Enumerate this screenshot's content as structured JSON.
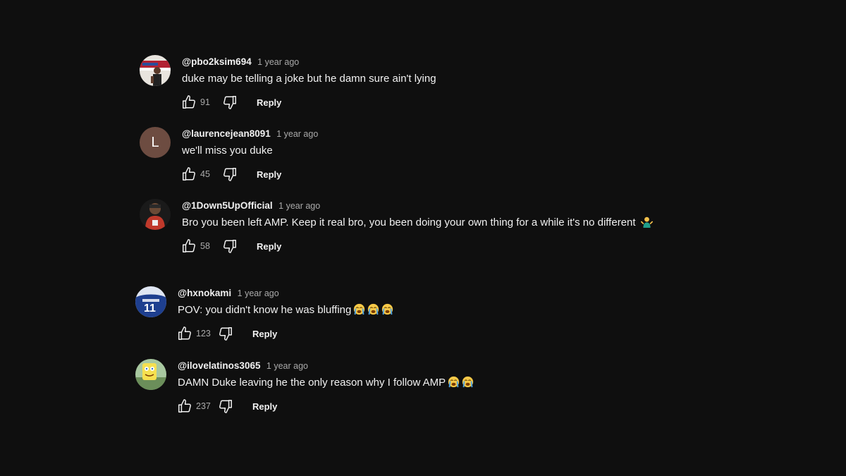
{
  "comments": [
    {
      "handle": "@pbo2ksim694",
      "time": "1 year ago",
      "text": "duke may be telling a joke but he damn sure ain't lying",
      "likes": "91",
      "reply_label": "Reply",
      "avatar_icon": "photo-avatar"
    },
    {
      "handle": "@laurencejean8091",
      "time": "1 year ago",
      "text": "we'll miss you duke",
      "likes": "45",
      "reply_label": "Reply",
      "avatar_letter": "L",
      "avatar_color": "#6d4c41"
    },
    {
      "handle": "@1Down5UpOfficial",
      "time": "1 year ago",
      "text": "Bro you been left AMP. Keep it real bro, you been doing your own thing for a while it's no different",
      "emoji": [
        "person-shrugging-emoji"
      ],
      "likes": "58",
      "reply_label": "Reply",
      "avatar_icon": "photo-avatar"
    },
    {
      "handle": "@hxnokami",
      "time": "1 year ago",
      "text": "POV: you didn't know he was bluffing",
      "emoji": [
        "loudly-crying-face-emoji",
        "loudly-crying-face-emoji",
        "loudly-crying-face-emoji"
      ],
      "likes": "123",
      "reply_label": "Reply",
      "avatar_icon": "photo-avatar"
    },
    {
      "handle": "@ilovelatinos3065",
      "time": "1 year ago",
      "text": "DAMN Duke leaving he the only reason why I follow AMP",
      "emoji": [
        "loudly-crying-face-emoji",
        "loudly-crying-face-emoji"
      ],
      "likes": "237",
      "reply_label": "Reply",
      "avatar_icon": "photo-avatar"
    }
  ],
  "icons": {
    "like": "thumbs-up-icon",
    "dislike": "thumbs-down-icon"
  },
  "colors": {
    "background": "#0f0f0f",
    "text_primary": "#f1f1f1",
    "text_secondary": "#aaaaaa"
  }
}
